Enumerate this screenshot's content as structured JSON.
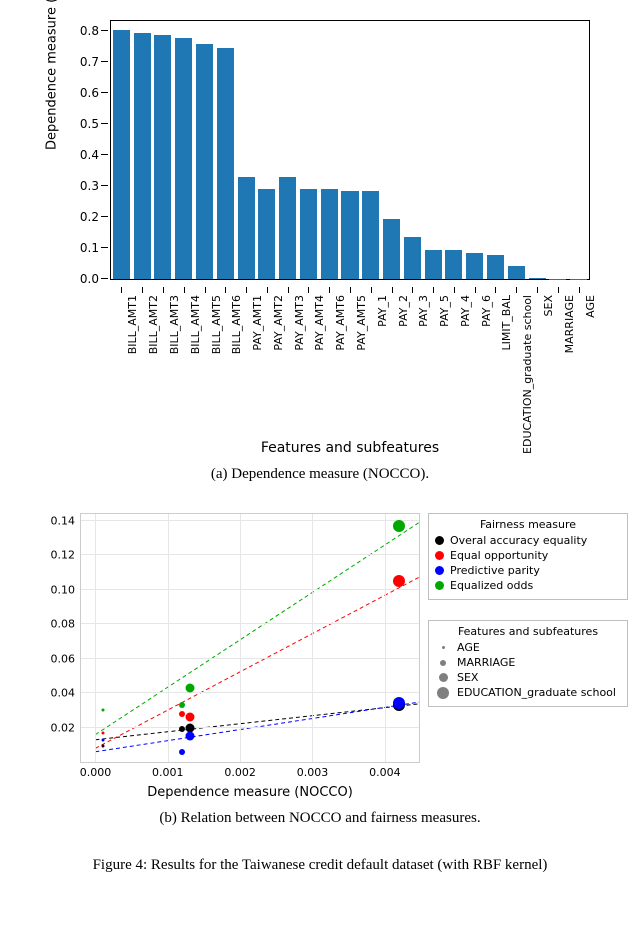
{
  "chart_data": [
    {
      "type": "bar",
      "ylabel": "Dependence measure (NOCCO)",
      "xlabel": "Features and subfeatures",
      "ylim": [
        0,
        0.8
      ],
      "yticks": [
        0.0,
        0.1,
        0.2,
        0.3,
        0.4,
        0.5,
        0.6,
        0.7,
        0.8
      ],
      "categories": [
        "BILL_AMT1",
        "BILL_AMT2",
        "BILL_AMT3",
        "BILL_AMT4",
        "BILL_AMT5",
        "BILL_AMT6",
        "PAY_AMT1",
        "PAY_AMT2",
        "PAY_AMT3",
        "PAY_AMT4",
        "PAY_AMT6",
        "PAY_AMT5",
        "PAY_1",
        "PAY_2",
        "PAY_3",
        "PAY_5",
        "PAY_4",
        "PAY_6",
        "LIMIT_BAL",
        "EDUCATION_graduate school",
        "SEX",
        "MARRIAGE",
        "AGE"
      ],
      "values": [
        0.805,
        0.795,
        0.787,
        0.78,
        0.76,
        0.745,
        0.33,
        0.29,
        0.33,
        0.29,
        0.29,
        0.285,
        0.285,
        0.195,
        0.135,
        0.095,
        0.095,
        0.085,
        0.078,
        0.043,
        0.0042,
        0.0013,
        0.0012,
        0.0001
      ]
    },
    {
      "type": "scatter",
      "xlabel": "Dependence measure (NOCCO)",
      "ylabel": "Fairness measure",
      "xlim": [
        -0.0002,
        0.0045
      ],
      "ylim": [
        0,
        0.145
      ],
      "xticks": [
        0.0,
        0.001,
        0.002,
        0.003,
        0.004
      ],
      "yticks": [
        0.02,
        0.04,
        0.06,
        0.08,
        0.1,
        0.12,
        0.14
      ],
      "legend_fairness": {
        "title": "Fairness measure",
        "items": [
          {
            "name": "Overal accuracy equality",
            "color": "#000000"
          },
          {
            "name": "Equal opportunity",
            "color": "#ff0000"
          },
          {
            "name": "Predictive parity",
            "color": "#0000ff"
          },
          {
            "name": "Equalized odds",
            "color": "#00a800"
          }
        ]
      },
      "legend_features": {
        "title": "Features and subfeatures",
        "items": [
          {
            "name": "AGE",
            "size": 3
          },
          {
            "name": "MARRIAGE",
            "size": 6
          },
          {
            "name": "SEX",
            "size": 9
          },
          {
            "name": "EDUCATION_graduate school",
            "size": 12
          }
        ]
      },
      "series_points": [
        {
          "feature": "AGE",
          "x": 0.0001,
          "black": 0.009,
          "red": 0.017,
          "blue": 0.013,
          "green": 0.03,
          "size": 3
        },
        {
          "feature": "MARRIAGE",
          "x": 0.0012,
          "black": 0.019,
          "red": 0.028,
          "blue": 0.006,
          "green": 0.033,
          "size": 6
        },
        {
          "feature": "SEX",
          "x": 0.0013,
          "black": 0.02,
          "red": 0.026,
          "blue": 0.015,
          "green": 0.043,
          "size": 9
        },
        {
          "feature": "EDUCATION_graduate school",
          "x": 0.0042,
          "black": 0.033,
          "red": 0.105,
          "blue": 0.034,
          "green": 0.137,
          "size": 12
        }
      ],
      "trend_lines": [
        {
          "color": "#000000",
          "y0": 0.013,
          "y1": 0.034
        },
        {
          "color": "#ff0000",
          "y0": 0.008,
          "y1": 0.108
        },
        {
          "color": "#0000ff",
          "y0": 0.006,
          "y1": 0.035
        },
        {
          "color": "#00a800",
          "y0": 0.016,
          "y1": 0.14
        }
      ]
    }
  ],
  "captions": {
    "a": "(a) Dependence measure (NOCCO).",
    "b": "(b) Relation between NOCCO and fairness measures.",
    "fig": "Figure 4: Results for the Taiwanese credit default dataset (with RBF kernel)"
  }
}
